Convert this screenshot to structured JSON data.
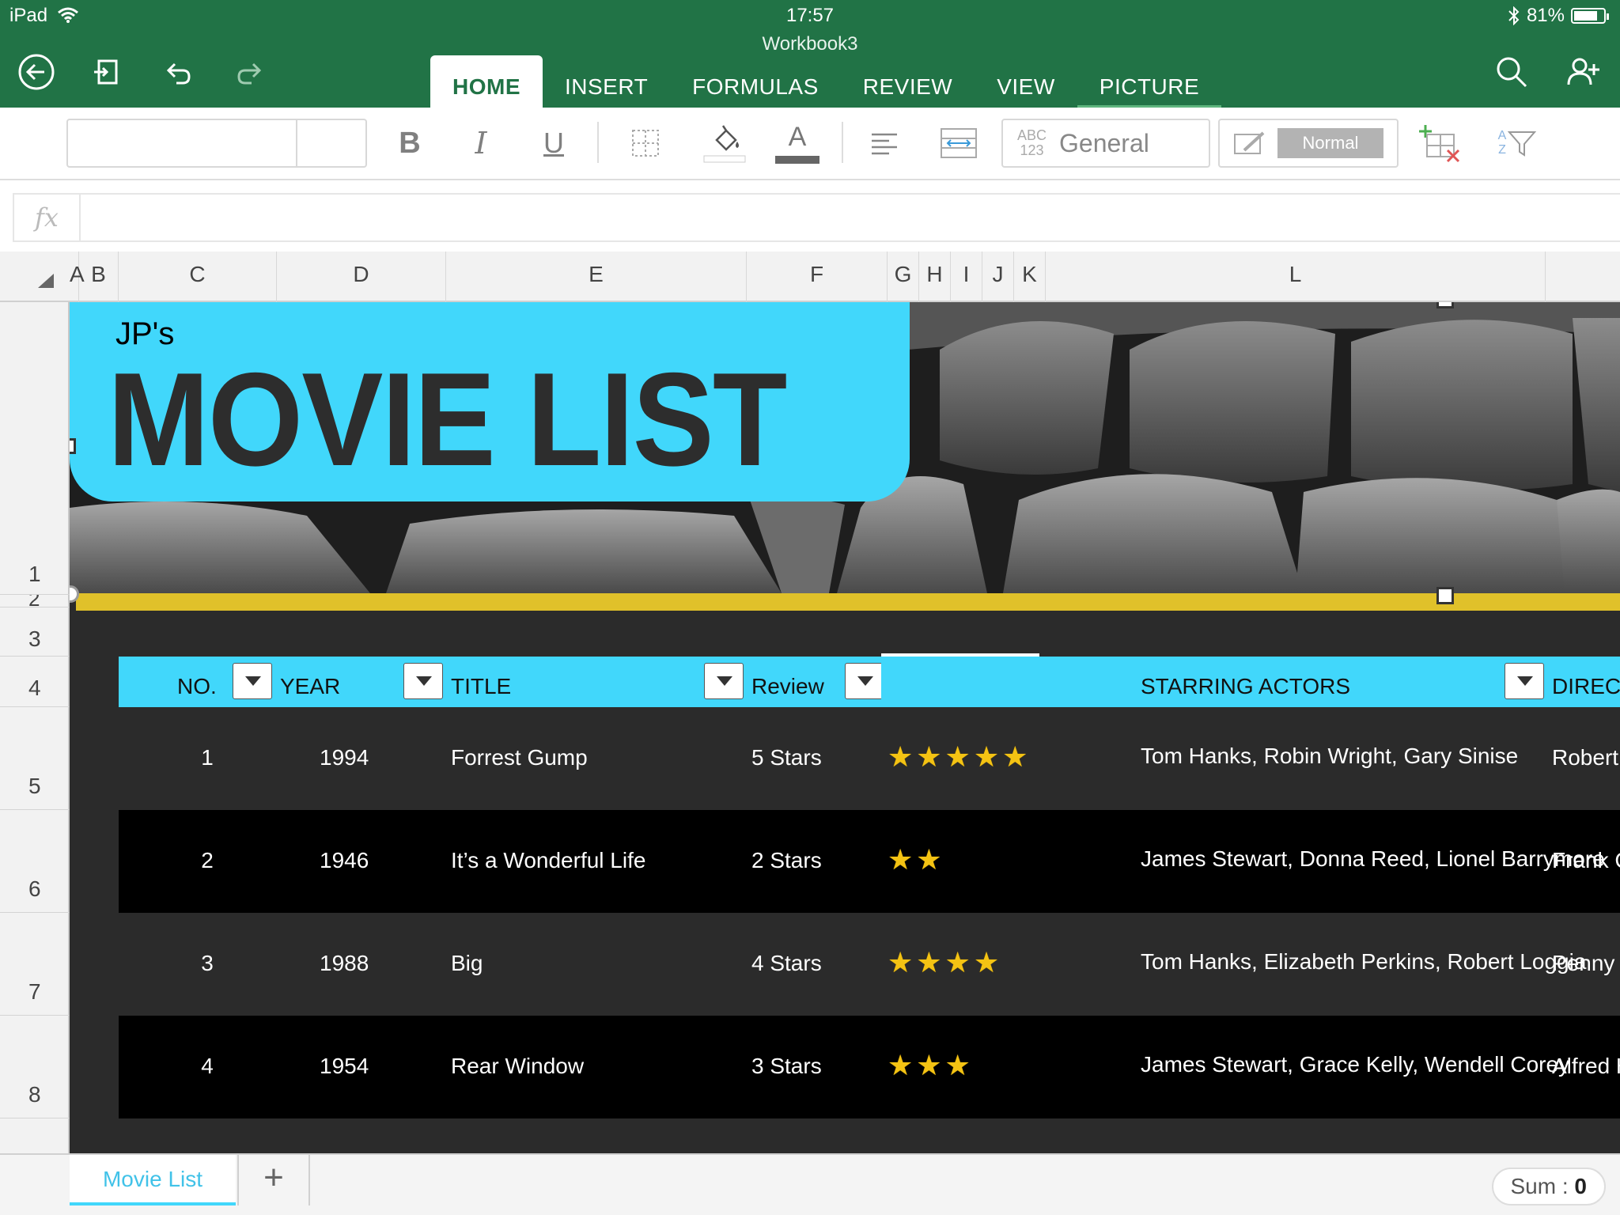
{
  "status": {
    "device": "iPad",
    "time": "17:57",
    "battery": "81%",
    "battery_level": 0.81
  },
  "window": {
    "title": "Workbook3"
  },
  "tabs": [
    {
      "label": "HOME",
      "active": true
    },
    {
      "label": "INSERT"
    },
    {
      "label": "FORMULAS"
    },
    {
      "label": "REVIEW"
    },
    {
      "label": "VIEW"
    },
    {
      "label": "PICTURE"
    }
  ],
  "ribbon": {
    "bold": "B",
    "italic": "I",
    "underline": "U",
    "font_color_glyph": "A",
    "number_format_icon_top": "ABC",
    "number_format_icon_bottom": "123",
    "number_format": "General",
    "cell_style": "Normal",
    "sort_icon_top": "A",
    "sort_icon_bottom": "Z"
  },
  "formula_bar": {
    "fx": "fx",
    "value": ""
  },
  "columns": [
    "A",
    "B",
    "C",
    "D",
    "E",
    "F",
    "G",
    "H",
    "I",
    "J",
    "K",
    "L"
  ],
  "rows": [
    "1",
    "2",
    "3",
    "4",
    "5",
    "6",
    "7",
    "8"
  ],
  "banner": {
    "owner": "JP's",
    "title": "MOVIE LIST"
  },
  "table": {
    "headers": {
      "no": "NO.",
      "year": "YEAR",
      "title": "TITLE",
      "review": "Review",
      "actors": "STARRING ACTORS",
      "director": "DIREC"
    },
    "rows": [
      {
        "no": "1",
        "year": "1994",
        "title": "Forrest Gump",
        "review": "5 Stars",
        "stars": "★★★★★",
        "rating": 5,
        "actors": "Tom Hanks, Robin Wright, Gary Sinise",
        "director": "Robert"
      },
      {
        "no": "2",
        "year": "1946",
        "title": "It’s a Wonderful Life",
        "review": "2 Stars",
        "stars": "★★",
        "rating": 2,
        "actors": "James Stewart, Donna Reed, Lionel Barrymore",
        "director": "Frank C"
      },
      {
        "no": "3",
        "year": "1988",
        "title": "Big",
        "review": "4 Stars",
        "stars": "★★★★",
        "rating": 4,
        "actors": "Tom Hanks, Elizabeth Perkins, Robert Loggia",
        "director": "Penny"
      },
      {
        "no": "4",
        "year": "1954",
        "title": "Rear Window",
        "review": "3 Stars",
        "stars": "★★★",
        "rating": 3,
        "actors": "James Stewart, Grace Kelly, Wendell Corey",
        "director": "Alfred H"
      }
    ]
  },
  "sheets": [
    {
      "label": "Movie List",
      "active": true
    }
  ],
  "add_sheet": "+",
  "sum": {
    "label": "Sum : ",
    "value": "0"
  },
  "colors": {
    "excel_green": "#217346",
    "accent_cyan": "#41d7fb",
    "yellow_line": "#e0c12a",
    "star": "#f4c313"
  }
}
